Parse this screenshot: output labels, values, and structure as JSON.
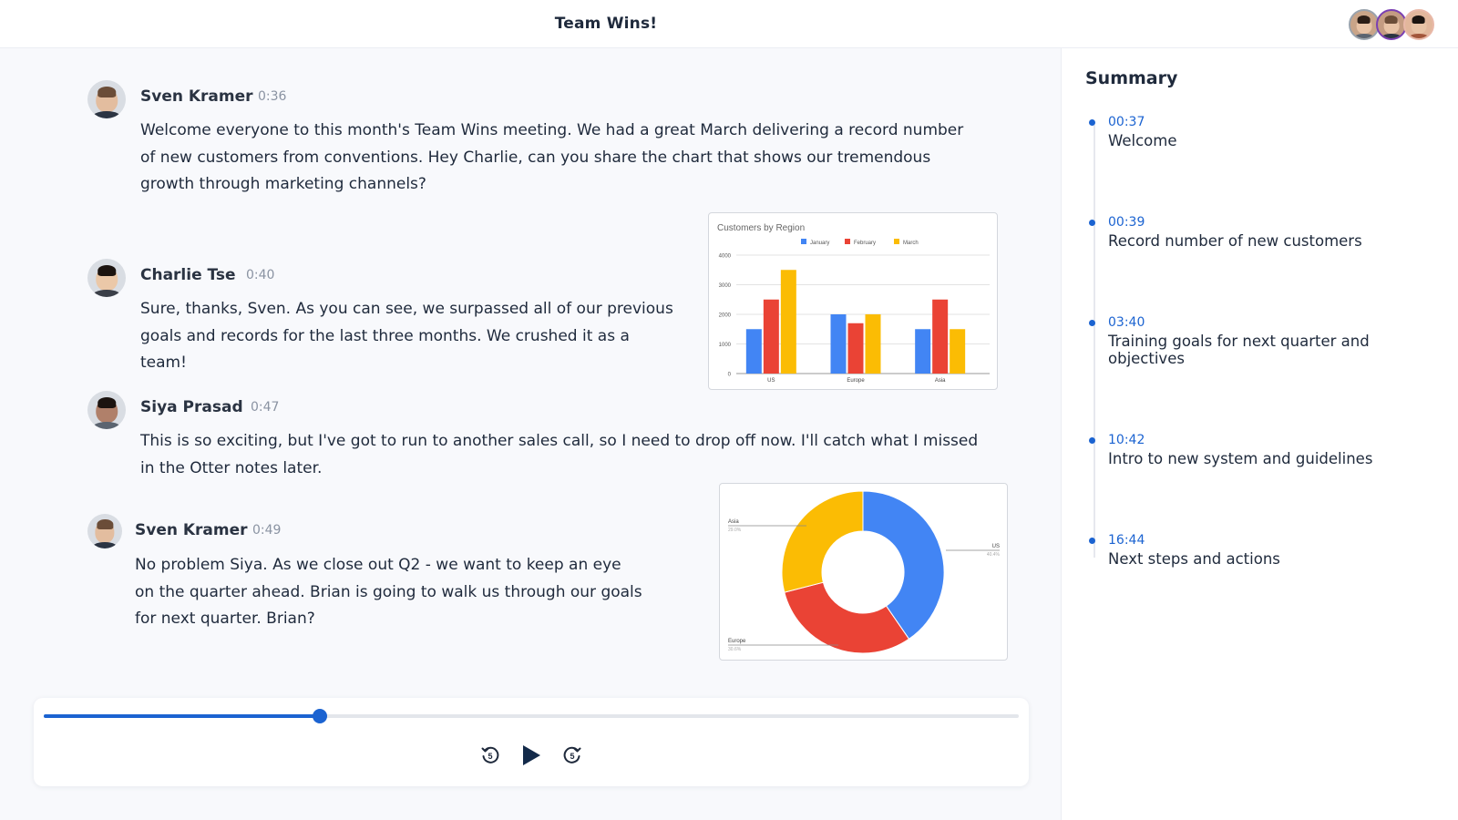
{
  "header": {
    "title": "Team Wins!",
    "participants": [
      {
        "name": "participant-1",
        "ring_color": "#9aa3ad"
      },
      {
        "name": "participant-2",
        "ring_color": "#7a3fb3"
      },
      {
        "name": "participant-3",
        "ring_color": "#e9b9a9"
      }
    ]
  },
  "transcript": [
    {
      "speaker": "Sven Kramer",
      "time": "0:36",
      "text": "Welcome everyone to this month's Team Wins meeting. We had a great March delivering a record number of new customers from conventions. Hey Charlie, can you share the chart that shows our tremendous growth through marketing channels?"
    },
    {
      "speaker": "Charlie Tse",
      "time": "0:40",
      "text": "Sure, thanks, Sven. As you can see, we surpassed all of our previous goals and records for the last three months. We crushed it as a team!"
    },
    {
      "speaker": "Siya Prasad",
      "time": "0:47",
      "text": "This is so exciting, but I've got to run to another sales call, so I need to drop off now. I'll catch what I missed in the Otter notes later."
    },
    {
      "speaker": "Sven Kramer",
      "time": "0:49",
      "text": "No problem Siya. As we close out Q2 - we want to keep an eye on the quarter ahead. Brian is going to walk us through our goals for next quarter. Brian?"
    }
  ],
  "chart_data": [
    {
      "type": "bar",
      "title": "Customers by Region",
      "categories": [
        "US",
        "Europe",
        "Asia"
      ],
      "series": [
        {
          "name": "January",
          "color": "#4285f4",
          "values": [
            1500,
            2000,
            1500
          ]
        },
        {
          "name": "February",
          "color": "#ea4335",
          "values": [
            2500,
            1700,
            2500
          ]
        },
        {
          "name": "March",
          "color": "#fbbc04",
          "values": [
            3500,
            2000,
            1500
          ]
        }
      ],
      "yticks": [
        "0",
        "1000",
        "2000",
        "3000",
        "4000"
      ],
      "ylim": [
        0,
        4000
      ],
      "xlabel": "",
      "ylabel": "",
      "grid": true,
      "legend": "top-center"
    },
    {
      "type": "pie",
      "title": "",
      "donut": true,
      "slices": [
        {
          "label": "US",
          "value": 40.4,
          "pct_label": "40.4%",
          "color": "#4285f4"
        },
        {
          "label": "Europe",
          "value": 30.6,
          "pct_label": "30.6%",
          "color": "#ea4335"
        },
        {
          "label": "Asia",
          "value": 29.0,
          "pct_label": "29.0%",
          "color": "#fbbc04"
        }
      ],
      "legend": "labels-with-leader-lines"
    }
  ],
  "player": {
    "progress_fraction": 0.283,
    "rewind_label": "5",
    "forward_label": "5",
    "accent": "#1b63d1"
  },
  "summary": {
    "title": "Summary",
    "items": [
      {
        "time": "00:37",
        "label": "Welcome"
      },
      {
        "time": "00:39",
        "label": "Record number of new customers"
      },
      {
        "time": "03:40",
        "label": "Training goals for next quarter and objectives"
      },
      {
        "time": "10:42",
        "label": "Intro to new system and guidelines"
      },
      {
        "time": "16:44",
        "label": "Next steps and actions"
      }
    ]
  }
}
